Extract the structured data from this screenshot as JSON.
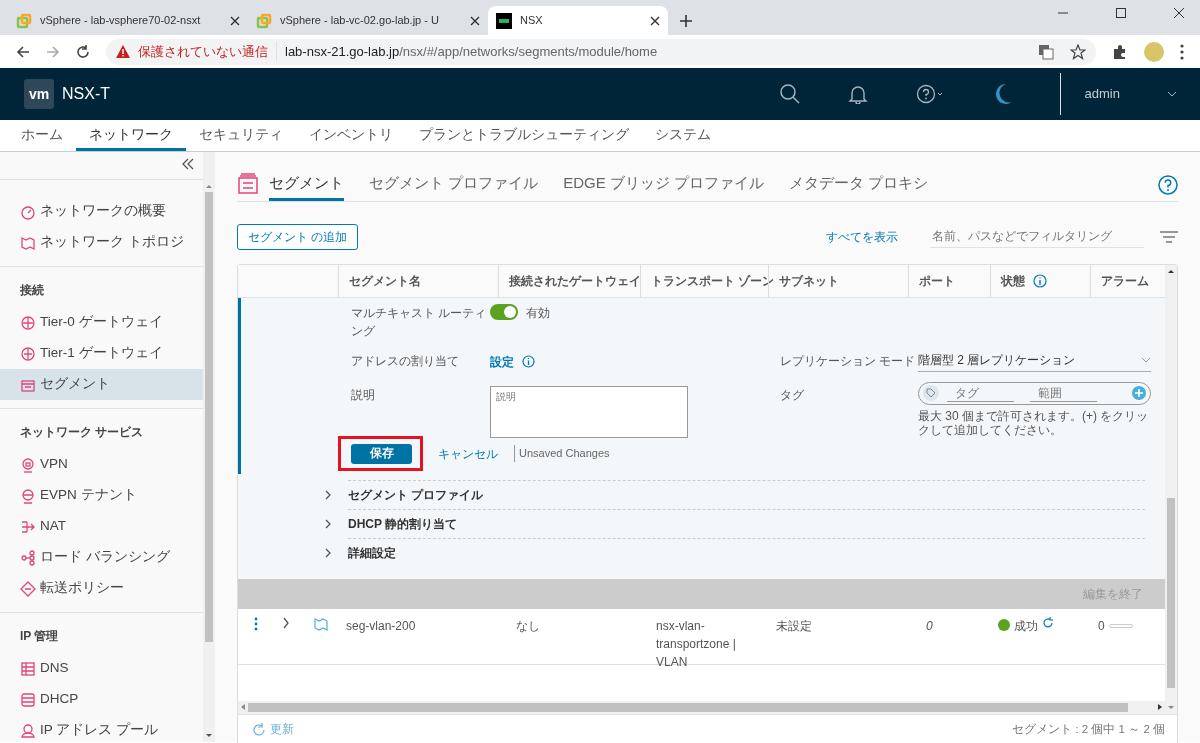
{
  "browser": {
    "tabs": [
      {
        "title": "vSphere - lab-vsphere70-02-nsxt",
        "selected": false
      },
      {
        "title": "vSphere - lab-vc-02.go-lab.jp - U",
        "selected": false
      },
      {
        "title": "NSX",
        "selected": true
      }
    ],
    "address": {
      "warning": "保護されていない通信",
      "host": "lab-nsx-21.go-lab.jp",
      "path": "/nsx/#/app/networks/segments/module/home"
    }
  },
  "app": {
    "logo": "vm",
    "product": "NSX-T",
    "user": "admin"
  },
  "main_nav": [
    {
      "label": "ホーム",
      "selected": false
    },
    {
      "label": "ネットワーク",
      "selected": true
    },
    {
      "label": "セキュリティ",
      "selected": false
    },
    {
      "label": "インベントリ",
      "selected": false
    },
    {
      "label": "プランとトラブルシューティング",
      "selected": false
    },
    {
      "label": "システム",
      "selected": false
    }
  ],
  "sidebar": {
    "sections": [
      {
        "items": [
          {
            "label": "ネットワークの概要",
            "selected": false
          },
          {
            "label": "ネットワーク トポロジ",
            "selected": false
          }
        ]
      },
      {
        "heading": "接続",
        "items": [
          {
            "label": "Tier-0 ゲートウェイ",
            "selected": false
          },
          {
            "label": "Tier-1 ゲートウェイ",
            "selected": false
          },
          {
            "label": "セグメント",
            "selected": true
          }
        ]
      },
      {
        "heading": "ネットワーク サービス",
        "items": [
          {
            "label": "VPN",
            "selected": false
          },
          {
            "label": "EVPN テナント",
            "selected": false
          },
          {
            "label": "NAT",
            "selected": false
          },
          {
            "label": "ロード バランシング",
            "selected": false
          },
          {
            "label": "転送ポリシー",
            "selected": false
          }
        ]
      },
      {
        "heading": "IP 管理",
        "items": [
          {
            "label": "DNS",
            "selected": false
          },
          {
            "label": "DHCP",
            "selected": false
          },
          {
            "label": "IP アドレス プール",
            "selected": false
          }
        ]
      }
    ]
  },
  "sub_tabs": [
    {
      "label": "セグメント",
      "selected": true
    },
    {
      "label": "セグメント プロファイル",
      "selected": false
    },
    {
      "label": "EDGE ブリッジ プロファイル",
      "selected": false
    },
    {
      "label": "メタデータ プロキシ",
      "selected": false
    }
  ],
  "toolbar": {
    "add_button": "セグメント の追加",
    "show_all": "すべてを表示",
    "filter_placeholder": "名前、パスなどでフィルタリング"
  },
  "table": {
    "columns": [
      {
        "label": "セグメント名"
      },
      {
        "label": "接続されたゲートウェイ"
      },
      {
        "label": "トランスポート ゾーン"
      },
      {
        "label": "サブネット"
      },
      {
        "label": "ポート"
      },
      {
        "label": "状態",
        "info": true
      },
      {
        "label": "アラーム"
      }
    ],
    "editor": {
      "multicast": {
        "label": "マルチキャスト ルーティング",
        "on": true,
        "value": "有効"
      },
      "address": {
        "label": "アドレスの割り当て",
        "link": "設定"
      },
      "description": {
        "label": "説明",
        "placeholder": "説明"
      },
      "replication": {
        "label": "レプリケーション モード",
        "value": "階層型 2 層レプリケーション"
      },
      "tags": {
        "label": "タグ",
        "tag_placeholder": "タグ",
        "scope_placeholder": "範囲",
        "hint": "最大 30 個まで許可されます。(+) をクリックして追加してください。"
      },
      "save": {
        "label": "保存",
        "highlighted": true
      },
      "cancel": "キャンセル",
      "status": "Unsaved Changes",
      "sections": [
        {
          "label": "セグメント プロファイル",
          "expanded": false
        },
        {
          "label": "DHCP 静的割り当て",
          "expanded": false
        },
        {
          "label": "詳細設定",
          "expanded": false
        }
      ],
      "end_edit": {
        "label": "編集を終了",
        "disabled": true
      }
    },
    "rows": [
      {
        "name": "seg-vlan-200",
        "gateway": "なし",
        "transport_zone": "nsx-vlan-transportzone | VLAN",
        "subnet": "未設定",
        "ports": "0",
        "status": {
          "label": "成功",
          "color": "#5aa220"
        },
        "alarms": "0"
      }
    ],
    "refresh": "更新",
    "count": "セグメント : 2 個中 1 ～ 2 個"
  }
}
